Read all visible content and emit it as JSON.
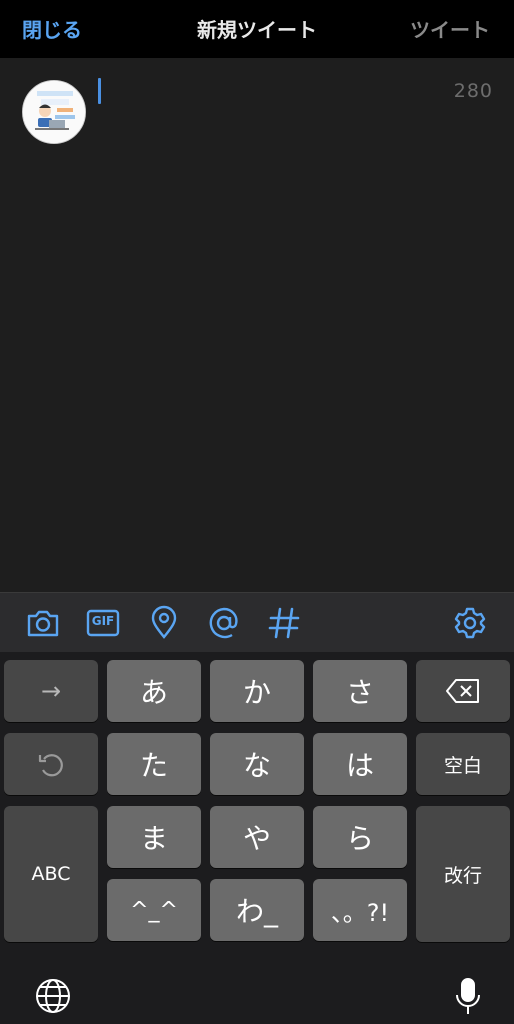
{
  "nav": {
    "close_label": "閉じる",
    "title": "新規ツイート",
    "tweet_label": "ツイート"
  },
  "compose": {
    "char_counter": "280",
    "text": ""
  },
  "toolbar": {
    "icons": [
      "camera-icon",
      "gif-icon",
      "location-icon",
      "mention-icon",
      "hashtag-icon",
      "settings-icon"
    ],
    "gif_label": "GIF"
  },
  "keyboard": {
    "row1": [
      "→",
      "あ",
      "か",
      "さ"
    ],
    "row2": [
      "た",
      "な",
      "は",
      "空白"
    ],
    "row3": [
      "ABC",
      "ま",
      "や",
      "ら",
      "改行"
    ],
    "row4": [
      "^_^",
      "わ_",
      "、。?!"
    ]
  },
  "colors": {
    "accent": "#5aa5f2",
    "background": "#1e1e1e",
    "key": "#6b6b6b",
    "func_key": "#474747"
  }
}
